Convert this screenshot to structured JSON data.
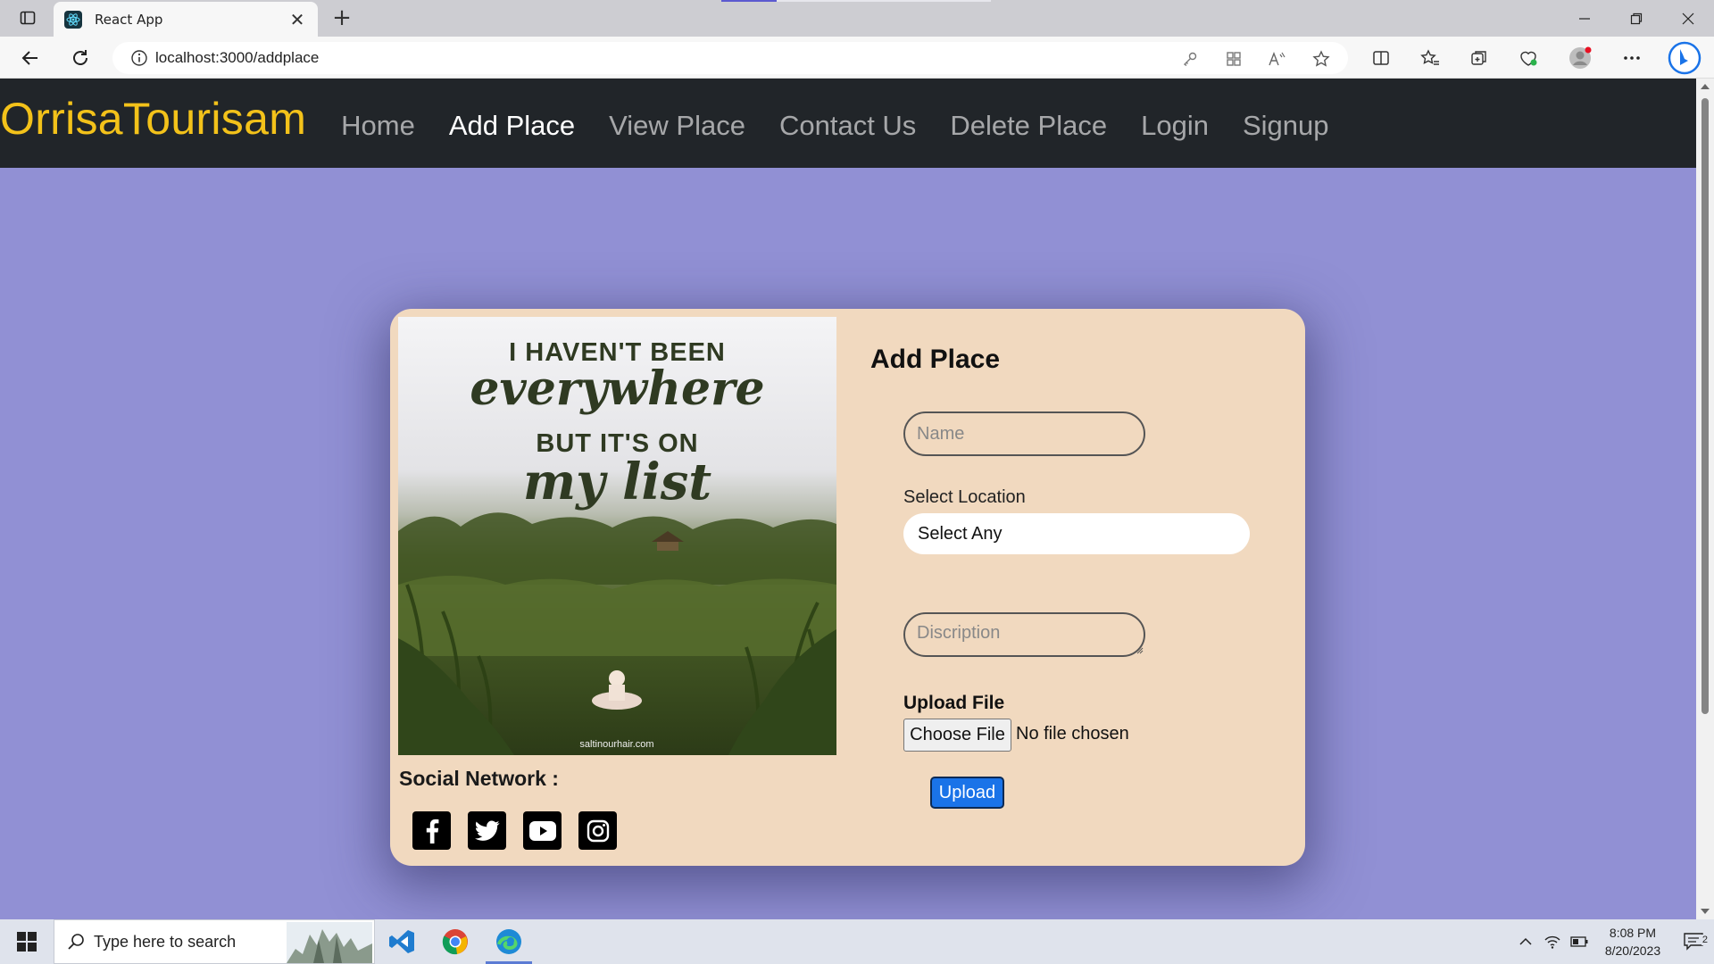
{
  "browser": {
    "tab_title": "React App",
    "tab_close": "✕",
    "new_tab": "+",
    "url": "localhost:3000/addplace",
    "window": {
      "minimize": "—",
      "restore": "❐",
      "close": "✕"
    }
  },
  "navbar": {
    "brand": "OrrisaTourisam",
    "links": [
      {
        "label": "Home",
        "active": false
      },
      {
        "label": "Add Place",
        "active": true
      },
      {
        "label": "View Place",
        "active": false
      },
      {
        "label": "Contact Us",
        "active": false
      },
      {
        "label": "Delete Place",
        "active": false
      },
      {
        "label": "Login",
        "active": false
      },
      {
        "label": "Signup",
        "active": false
      }
    ]
  },
  "poster": {
    "line1": "I HAVEN'T BEEN",
    "line2": "everywhere",
    "line3": "BUT IT'S ON",
    "line4": "my list",
    "credit": "saltinourhair.com"
  },
  "social": {
    "title": "Social Network :",
    "icons": [
      "facebook-icon",
      "twitter-icon",
      "youtube-icon",
      "instagram-icon"
    ]
  },
  "form": {
    "title": "Add Place",
    "name_placeholder": "Name",
    "location_label": "Select Location",
    "location_selected": "Select Any",
    "description_placeholder": "Discription",
    "upload_label": "Upload File",
    "choose_button": "Choose File",
    "no_file_text": "No file chosen",
    "upload_button": "Upload"
  },
  "taskbar": {
    "search_placeholder": "Type here to search",
    "time": "8:08 PM",
    "date": "8/20/2023",
    "notification_count": "2"
  },
  "colors": {
    "page_background": "#9190d4",
    "navbar": "#212529",
    "brand": "#f3c21a",
    "card": "#f1d9bf",
    "upload_button": "#1a73e8"
  }
}
